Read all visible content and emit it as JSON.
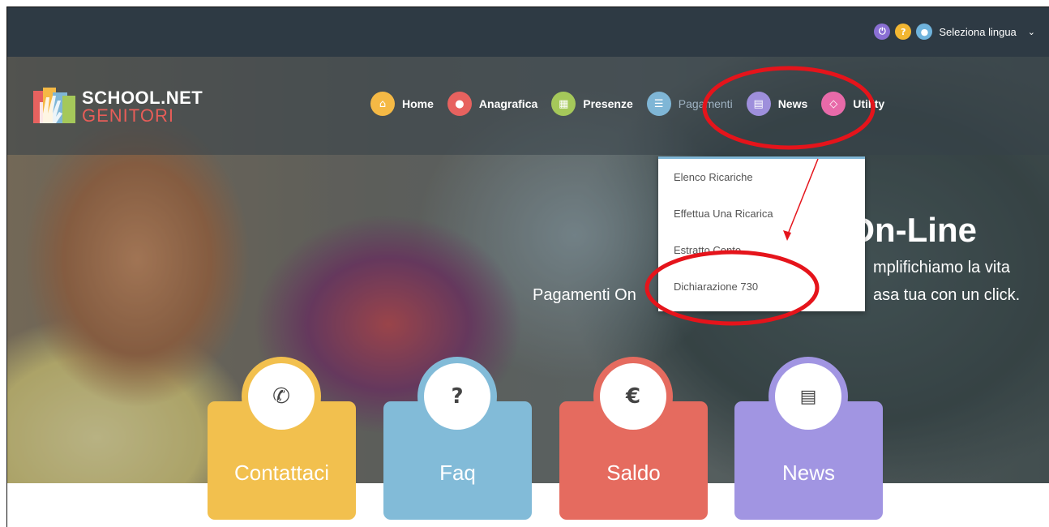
{
  "topbar": {
    "language_label": "Seleziona lingua",
    "icons": [
      "power-icon",
      "help-icon",
      "globe-icon",
      "chevron-down-icon"
    ]
  },
  "logo": {
    "line1": "SCHOOL.NET",
    "line2": "GENITORI"
  },
  "nav": {
    "items": [
      {
        "label": "Home",
        "icon": "home-icon",
        "color": "#f5b945"
      },
      {
        "label": "Anagrafica",
        "icon": "user-icon",
        "color": "#e7625f"
      },
      {
        "label": "Presenze",
        "icon": "calendar-icon",
        "color": "#a5c85a"
      },
      {
        "label": "Pagamenti",
        "icon": "list-icon",
        "color": "#7fb6d6"
      },
      {
        "label": "News",
        "icon": "newspaper-icon",
        "color": "#9e8fdc"
      },
      {
        "label": "Utility",
        "icon": "utility-icon",
        "color": "#e86aa9"
      }
    ]
  },
  "dropdown": {
    "items": [
      "Elenco Ricariche",
      "Effettua Una Ricarica",
      "Estratto Conto",
      "Dichiarazione 730"
    ]
  },
  "hero": {
    "title": "ti On-Line",
    "subtitle_line1": "mplifichiamo la vita",
    "subtitle_line2": "Pagamenti On"
  },
  "hero_sub2_tail": "asa tua con un click.",
  "tiles": [
    {
      "label": "Contattaci",
      "icon": "phone-icon",
      "color": "#f2c04e",
      "ring": "#f2c04e"
    },
    {
      "label": "Faq",
      "icon": "question-icon",
      "color": "#82bbd8",
      "ring": "#82bbd8"
    },
    {
      "label": "Saldo",
      "icon": "euro-icon",
      "color": "#e56b5f",
      "ring": "#e56b5f"
    },
    {
      "label": "News",
      "icon": "newspaper-icon",
      "color": "#a195e2",
      "ring": "#a195e2"
    }
  ]
}
